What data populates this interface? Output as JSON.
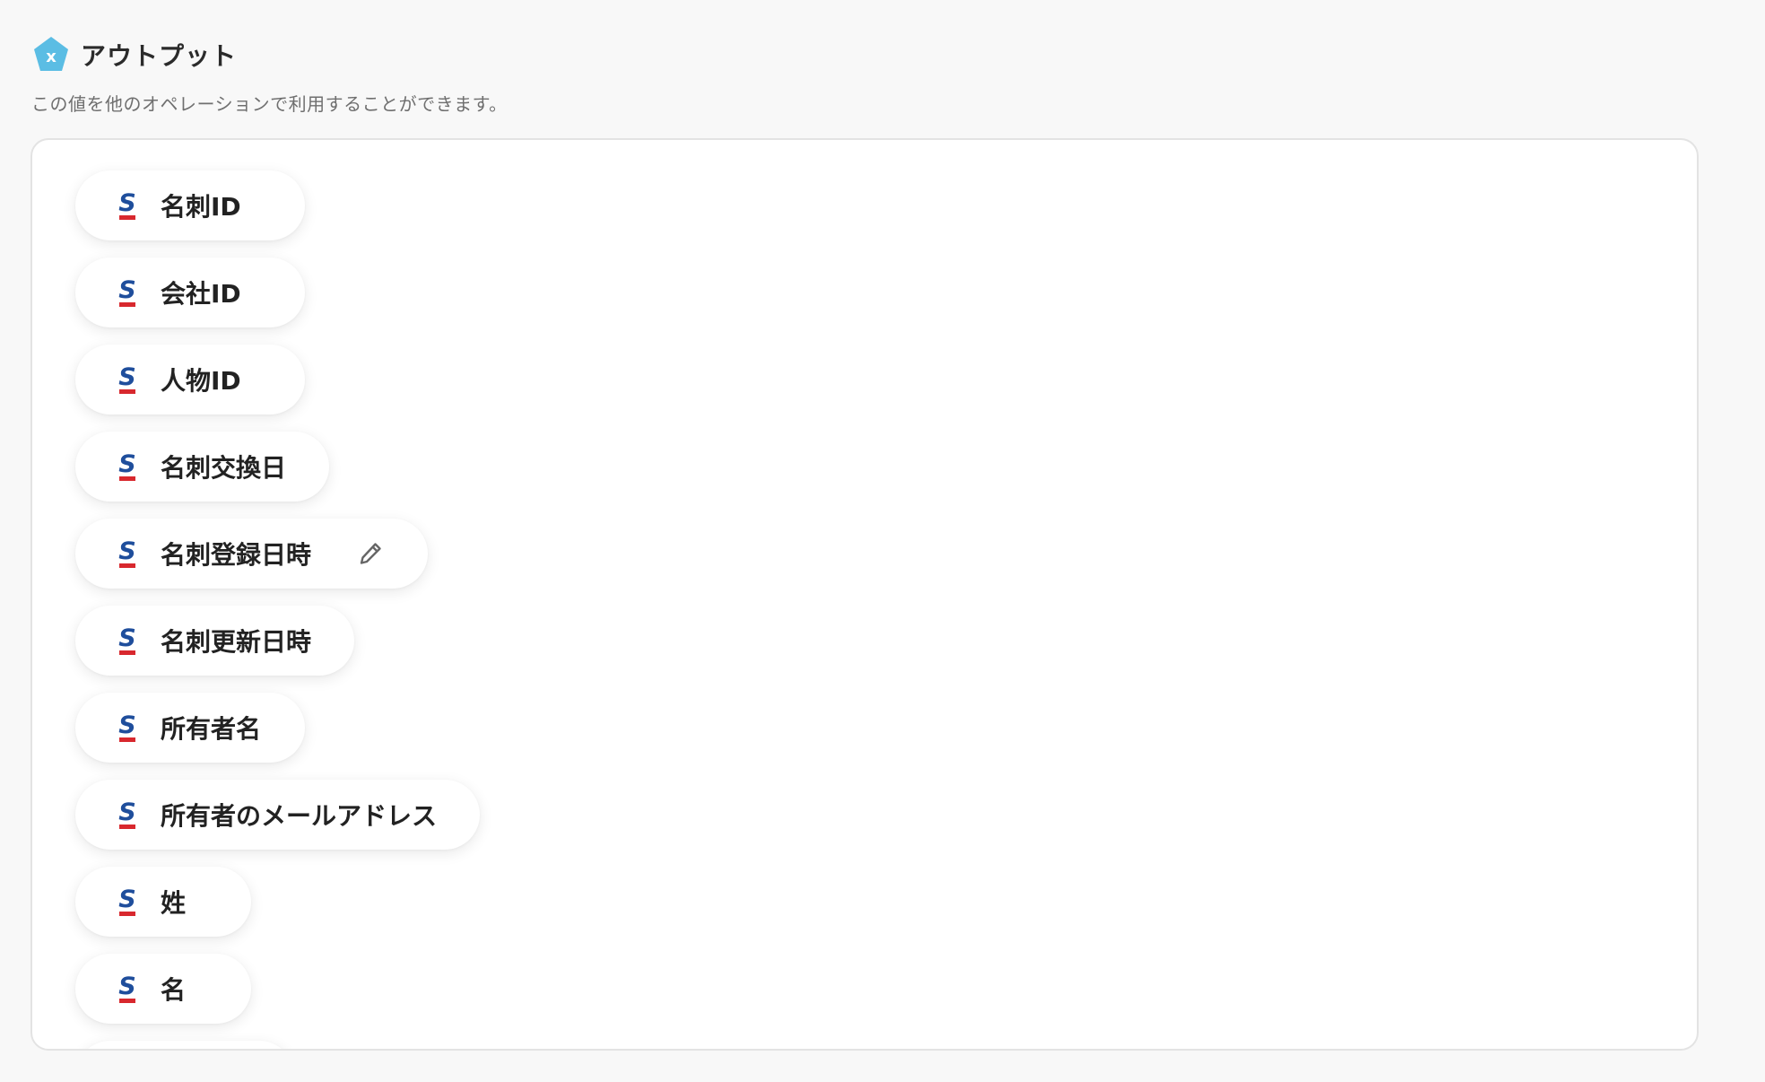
{
  "header": {
    "title": "アウトプット",
    "icon": "output-variable-icon",
    "icon_color": "#5bbde4"
  },
  "description": "この値を他のオペレーションで利用することができます。",
  "output_items": [
    {
      "label": "名刺ID",
      "icon": "sansan-s-icon"
    },
    {
      "label": "会社ID",
      "icon": "sansan-s-icon"
    },
    {
      "label": "人物ID",
      "icon": "sansan-s-icon"
    },
    {
      "label": "名刺交換日",
      "icon": "sansan-s-icon"
    },
    {
      "label": "名刺登録日時",
      "icon": "sansan-s-icon",
      "editable": true,
      "edit_icon": "pencil-edit-icon"
    },
    {
      "label": "名刺更新日時",
      "icon": "sansan-s-icon"
    },
    {
      "label": "所有者名",
      "icon": "sansan-s-icon"
    },
    {
      "label": "所有者のメールアドレス",
      "icon": "sansan-s-icon"
    },
    {
      "label": "姓",
      "icon": "sansan-s-icon"
    },
    {
      "label": "名",
      "icon": "sansan-s-icon"
    }
  ],
  "colors": {
    "sansan_blue": "#1f4e9c",
    "sansan_red": "#d8282e",
    "panel_border": "#e3e3e3",
    "page_background": "#f8f8f8"
  }
}
